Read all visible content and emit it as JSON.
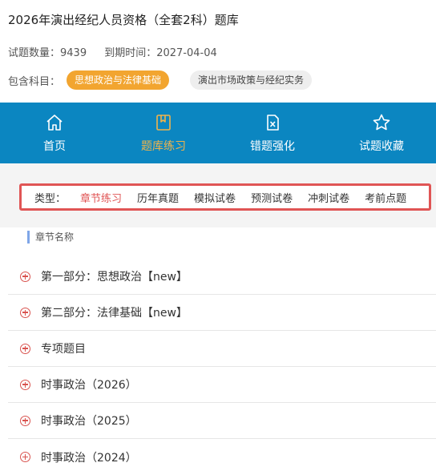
{
  "header": {
    "title": "2026年演出经纪人员资格（全套2科）题库",
    "question_count": "试题数量：9439",
    "expiry": "到期时间：2027-04-04",
    "subjects_label": "包含科目：",
    "subjects": [
      "思想政治与法律基础",
      "演出市场政策与经纪实务"
    ]
  },
  "nav": {
    "items": [
      {
        "label": "首页",
        "icon": "home-icon"
      },
      {
        "label": "题库练习",
        "icon": "bookmark-book-icon"
      },
      {
        "label": "错题强化",
        "icon": "error-doc-icon"
      },
      {
        "label": "试题收藏",
        "icon": "star-icon"
      }
    ],
    "active_index": 1
  },
  "typebar": {
    "label": "类型：",
    "tabs": [
      "章节练习",
      "历年真题",
      "模拟试卷",
      "预测试卷",
      "冲刺试卷",
      "考前点题"
    ],
    "active_index": 0
  },
  "section": {
    "title": "章节名称"
  },
  "chapters": [
    "第一部分：思想政治【new】",
    "第二部分：法律基础【new】",
    "专项题目",
    "时事政治（2026）",
    "时事政治（2025）",
    "时事政治（2024）"
  ],
  "colors": {
    "nav_bg": "#0b86c1",
    "accent_orange": "#f2a530",
    "accent_red": "#e05555"
  }
}
